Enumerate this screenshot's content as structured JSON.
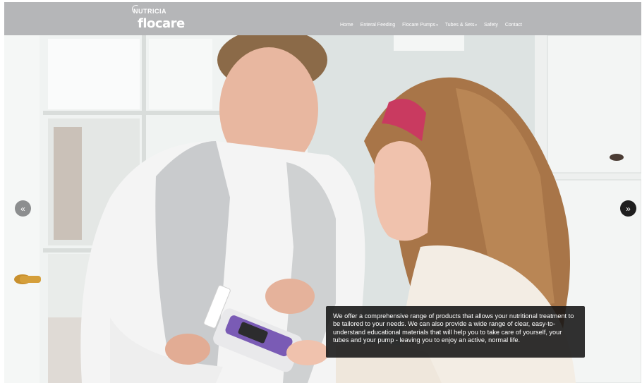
{
  "brand": {
    "top": "NUTRICIA",
    "name": "flocare"
  },
  "nav": [
    {
      "label": "Home",
      "has_dropdown": false
    },
    {
      "label": "Enteral Feeding",
      "has_dropdown": false
    },
    {
      "label": "Flocare Pumps",
      "has_dropdown": true
    },
    {
      "label": "Tubes & Sets",
      "has_dropdown": true
    },
    {
      "label": "Safety",
      "has_dropdown": false
    },
    {
      "label": "Contact",
      "has_dropdown": false
    }
  ],
  "slider": {
    "prev": "«",
    "next": "»",
    "caption": "We offer a comprehensive range of products that allows your nutritional treatment to be tailored to your needs. We can also provide a wide range of clear, easy-to-understand educational materials that will help you to take care of yourself, your tubes and your pump - leaving you to enjoy an active, normal life."
  },
  "colors": {
    "header_bg": "#b5b6b8",
    "caption_bg": "#141414",
    "pump_purple": "#7a5bb5",
    "headband": "#c93a60"
  }
}
